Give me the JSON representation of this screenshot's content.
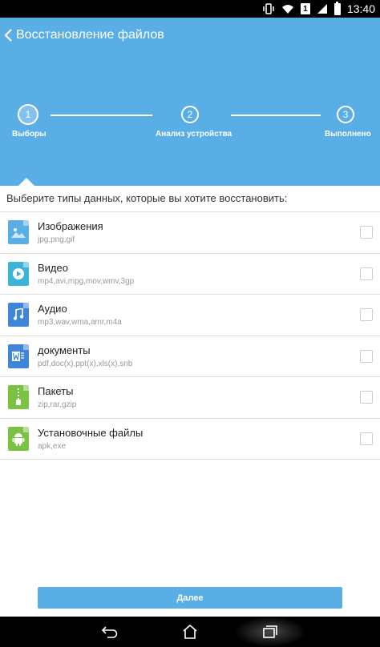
{
  "status_bar": {
    "sim_label": "1",
    "time": "13:40",
    "icons": [
      "vibrate-icon",
      "wifi-icon",
      "sim-icon",
      "signal-icon",
      "battery-icon"
    ]
  },
  "app_bar": {
    "title": "Восстановление файлов"
  },
  "stepper": {
    "steps": [
      {
        "number": "1",
        "label": "Выборы"
      },
      {
        "number": "2",
        "label": "Анализ устройства"
      },
      {
        "number": "3",
        "label": "Выполнено"
      }
    ]
  },
  "prompt": "Выберите типы данных, которые вы хотите восстановить:",
  "file_types": [
    {
      "name": "Изображения",
      "extensions": "jpg,png,gif",
      "icon": "image-icon",
      "color": "#5aaee6",
      "checked": false
    },
    {
      "name": "Видео",
      "extensions": "mp4,avi,mpg,mov,wmv,3gp",
      "icon": "video-icon",
      "color": "#3cb4d8",
      "checked": false
    },
    {
      "name": "Аудио",
      "extensions": "mp3,wav,wma,amr,m4a",
      "icon": "audio-icon",
      "color": "#3f86d8",
      "checked": false
    },
    {
      "name": "документы",
      "extensions": "pdf,doc(x),ppt(x),xls(x),snb",
      "icon": "document-icon",
      "color": "#3f86d8",
      "checked": false
    },
    {
      "name": "Пакеты",
      "extensions": "zip,rar,gzip",
      "icon": "archive-icon",
      "color": "#7cc242",
      "checked": false
    },
    {
      "name": "Установочные файлы",
      "extensions": "apk,exe",
      "icon": "android-icon",
      "color": "#7cc242",
      "checked": false
    }
  ],
  "next_button": "Далее",
  "colors": {
    "accent": "#5aaee6",
    "nav_bar": "#000000"
  }
}
